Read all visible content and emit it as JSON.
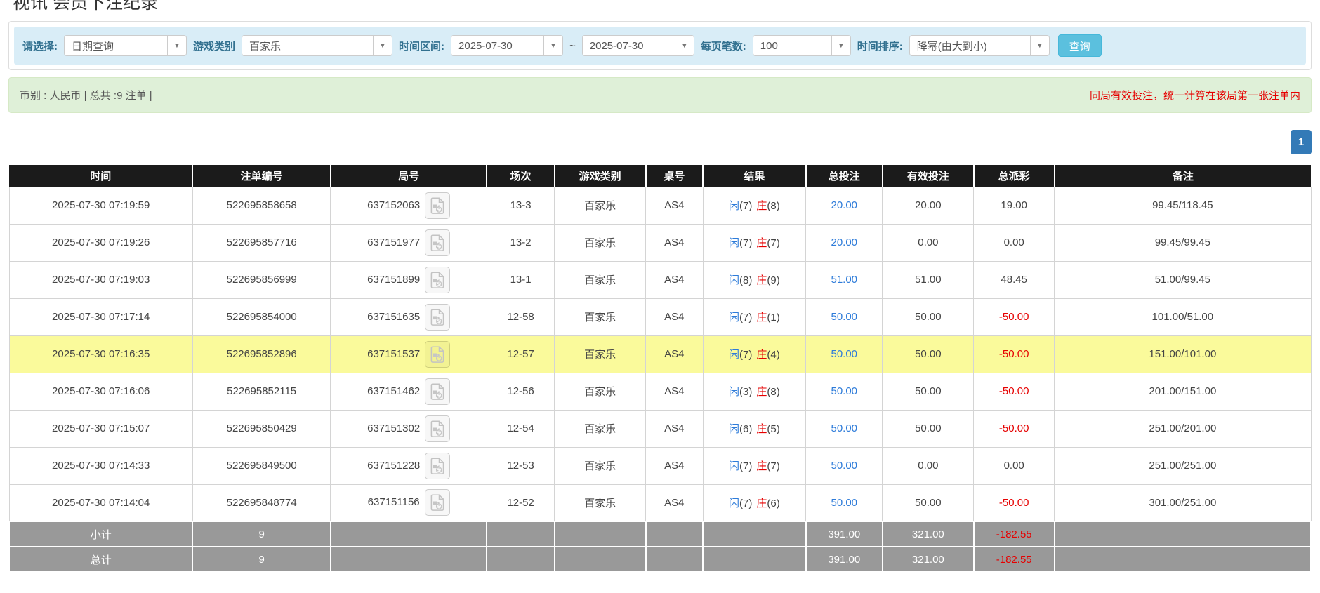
{
  "page": {
    "title": "视讯 会员下注纪录"
  },
  "filter": {
    "select_label": "请选择:",
    "select_value": "日期查询",
    "game_label": "游戏类别",
    "game_value": "百家乐",
    "range_label": "时间区间:",
    "date_from": "2025-07-30",
    "tilde": "~",
    "date_to": "2025-07-30",
    "per_page_label": "每页笔数:",
    "per_page_value": "100",
    "sort_label": "时间排序:",
    "sort_value": "降幂(由大到小)",
    "query_button": "查询",
    "caret_glyph": "▼"
  },
  "notice": {
    "currency_summary": "币别 : 人民币 | 总共 :9 注单 |",
    "right_notice": "同局有效投注，统一计算在该局第一张注单内"
  },
  "pagination": {
    "page": "1"
  },
  "table": {
    "columns": [
      "时间",
      "注单编号",
      "局号",
      "场次",
      "游戏类别",
      "桌号",
      "结果",
      "总投注",
      "有效投注",
      "总派彩",
      "备注"
    ],
    "rows": [
      {
        "time": "2025-07-30 07:19:59",
        "bet_id": "522695858658",
        "round_id": "637152063",
        "session": "13-3",
        "game": "百家乐",
        "table_no": "AS4",
        "player": "闲",
        "player_score": "(7)",
        "banker": "庄",
        "banker_score": "(8)",
        "total_bet": "20.00",
        "valid_bet": "20.00",
        "payout": "19.00",
        "payout_negative": false,
        "remark": "99.45/118.45",
        "highlight": false
      },
      {
        "time": "2025-07-30 07:19:26",
        "bet_id": "522695857716",
        "round_id": "637151977",
        "session": "13-2",
        "game": "百家乐",
        "table_no": "AS4",
        "player": "闲",
        "player_score": "(7)",
        "banker": "庄",
        "banker_score": "(7)",
        "total_bet": "20.00",
        "valid_bet": "0.00",
        "payout": "0.00",
        "payout_negative": false,
        "remark": "99.45/99.45",
        "highlight": false
      },
      {
        "time": "2025-07-30 07:19:03",
        "bet_id": "522695856999",
        "round_id": "637151899",
        "session": "13-1",
        "game": "百家乐",
        "table_no": "AS4",
        "player": "闲",
        "player_score": "(8)",
        "banker": "庄",
        "banker_score": "(9)",
        "total_bet": "51.00",
        "valid_bet": "51.00",
        "payout": "48.45",
        "payout_negative": false,
        "remark": "51.00/99.45",
        "highlight": false
      },
      {
        "time": "2025-07-30 07:17:14",
        "bet_id": "522695854000",
        "round_id": "637151635",
        "session": "12-58",
        "game": "百家乐",
        "table_no": "AS4",
        "player": "闲",
        "player_score": "(7)",
        "banker": "庄",
        "banker_score": "(1)",
        "total_bet": "50.00",
        "valid_bet": "50.00",
        "payout": "-50.00",
        "payout_negative": true,
        "remark": "101.00/51.00",
        "highlight": false
      },
      {
        "time": "2025-07-30 07:16:35",
        "bet_id": "522695852896",
        "round_id": "637151537",
        "session": "12-57",
        "game": "百家乐",
        "table_no": "AS4",
        "player": "闲",
        "player_score": "(7)",
        "banker": "庄",
        "banker_score": "(4)",
        "total_bet": "50.00",
        "valid_bet": "50.00",
        "payout": "-50.00",
        "payout_negative": true,
        "remark": "151.00/101.00",
        "highlight": true
      },
      {
        "time": "2025-07-30 07:16:06",
        "bet_id": "522695852115",
        "round_id": "637151462",
        "session": "12-56",
        "game": "百家乐",
        "table_no": "AS4",
        "player": "闲",
        "player_score": "(3)",
        "banker": "庄",
        "banker_score": "(8)",
        "total_bet": "50.00",
        "valid_bet": "50.00",
        "payout": "-50.00",
        "payout_negative": true,
        "remark": "201.00/151.00",
        "highlight": false
      },
      {
        "time": "2025-07-30 07:15:07",
        "bet_id": "522695850429",
        "round_id": "637151302",
        "session": "12-54",
        "game": "百家乐",
        "table_no": "AS4",
        "player": "闲",
        "player_score": "(6)",
        "banker": "庄",
        "banker_score": "(5)",
        "total_bet": "50.00",
        "valid_bet": "50.00",
        "payout": "-50.00",
        "payout_negative": true,
        "remark": "251.00/201.00",
        "highlight": false
      },
      {
        "time": "2025-07-30 07:14:33",
        "bet_id": "522695849500",
        "round_id": "637151228",
        "session": "12-53",
        "game": "百家乐",
        "table_no": "AS4",
        "player": "闲",
        "player_score": "(7)",
        "banker": "庄",
        "banker_score": "(7)",
        "total_bet": "50.00",
        "valid_bet": "0.00",
        "payout": "0.00",
        "payout_negative": false,
        "remark": "251.00/251.00",
        "highlight": false
      },
      {
        "time": "2025-07-30 07:14:04",
        "bet_id": "522695848774",
        "round_id": "637151156",
        "session": "12-52",
        "game": "百家乐",
        "table_no": "AS4",
        "player": "闲",
        "player_score": "(7)",
        "banker": "庄",
        "banker_score": "(6)",
        "total_bet": "50.00",
        "valid_bet": "50.00",
        "payout": "-50.00",
        "payout_negative": true,
        "remark": "301.00/251.00",
        "highlight": false
      }
    ],
    "footer_rows": [
      {
        "label": "小计",
        "count": "9",
        "total_bet": "391.00",
        "valid_bet": "321.00",
        "payout": "-182.55",
        "payout_negative": true
      },
      {
        "label": "总计",
        "count": "9",
        "total_bet": "391.00",
        "valid_bet": "321.00",
        "payout": "-182.55",
        "payout_negative": true
      }
    ]
  },
  "colors": {
    "filter_bar_bg": "#d9edf7",
    "summary_bar_bg": "#dff0d8",
    "query_button_bg": "#5bc0de",
    "pagination_bg": "#337ab7",
    "header_bg": "#1b1b1b",
    "footer_bg": "#999999",
    "highlight_yellow": "#fafa9b",
    "accent_blue_link": "#2d7bd9",
    "player_blue": "#2d7bd9",
    "banker_red": "#e60000",
    "negative_red": "#e60000",
    "notice_red": "#e60000"
  }
}
